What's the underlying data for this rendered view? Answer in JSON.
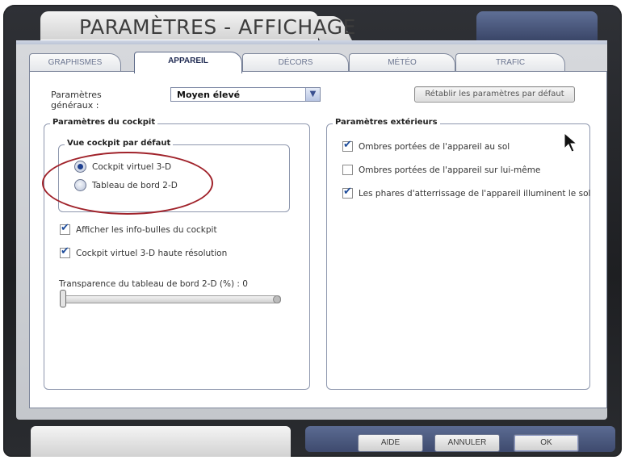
{
  "window": {
    "title": "PARAMÈTRES - AFFICHAGE"
  },
  "tabs": [
    {
      "label": "GRAPHISMES",
      "active": false
    },
    {
      "label": "APPAREIL",
      "active": true
    },
    {
      "label": "DÉCORS",
      "active": false
    },
    {
      "label": "MÉTÉO",
      "active": false
    },
    {
      "label": "TRAFIC",
      "active": false
    }
  ],
  "general": {
    "label": "Paramètres généraux :",
    "selected": "Moyen élevé",
    "reset_label": "Rétablir les paramètres par défaut"
  },
  "cockpit": {
    "group_label": "Paramètres du cockpit",
    "view_group_label": "Vue cockpit par défaut",
    "radio_3d": {
      "label": "Cockpit virtuel 3-D",
      "selected": true
    },
    "radio_2d": {
      "label": "Tableau de bord 2-D",
      "selected": false
    },
    "tooltips": {
      "label": "Afficher les info-bulles du cockpit",
      "checked": true
    },
    "hires": {
      "label": "Cockpit virtuel 3-D haute résolution",
      "checked": true
    },
    "transparency_label": "Transparence du tableau de bord 2-D (%) : 0",
    "transparency_value": 0
  },
  "exterior": {
    "group_label": "Paramètres extérieurs",
    "shadows_ground": {
      "label": "Ombres portées de l'appareil au sol",
      "checked": true
    },
    "shadows_self": {
      "label": "Ombres portées de l'appareil sur lui-même",
      "checked": false
    },
    "landing_lights": {
      "label": "Les phares d'atterrissage de l'appareil illuminent le sol",
      "checked": true
    }
  },
  "buttons": {
    "help": "AIDE",
    "cancel": "ANNULER",
    "ok": "OK"
  },
  "colors": {
    "accent": "#1d3f8f",
    "frame": "#2a2c30",
    "annotation": "#a0222a"
  }
}
